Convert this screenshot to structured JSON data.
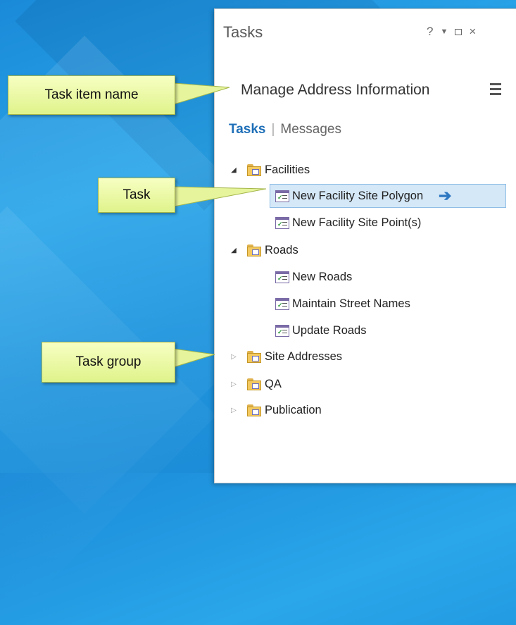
{
  "pane": {
    "title": "Tasks",
    "controls": {
      "help": "?",
      "pin": "▼",
      "close": "×"
    }
  },
  "task_item_name": "Manage Address Information",
  "tabs": {
    "tasks": "Tasks",
    "separator": "|",
    "messages": "Messages"
  },
  "tree": {
    "groups": [
      {
        "label": "Facilities",
        "expanded": true,
        "tasks": [
          {
            "label": "New Facility Site Polygon",
            "selected": true
          },
          {
            "label": "New Facility Site Point(s)"
          }
        ]
      },
      {
        "label": "Roads",
        "expanded": true,
        "tasks": [
          {
            "label": "New Roads"
          },
          {
            "label": "Maintain Street Names"
          },
          {
            "label": "Update Roads"
          }
        ]
      },
      {
        "label": "Site Addresses",
        "expanded": false,
        "tasks": []
      },
      {
        "label": "QA",
        "expanded": false,
        "tasks": []
      },
      {
        "label": "Publication",
        "expanded": false,
        "tasks": []
      }
    ]
  },
  "callouts": {
    "task_item_name": "Task item name",
    "task": "Task",
    "task_group": "Task group"
  },
  "colors": {
    "callout_fill": "#e9f7a4",
    "accent": "#1e6fb7",
    "selection": "#d5e8f8"
  }
}
